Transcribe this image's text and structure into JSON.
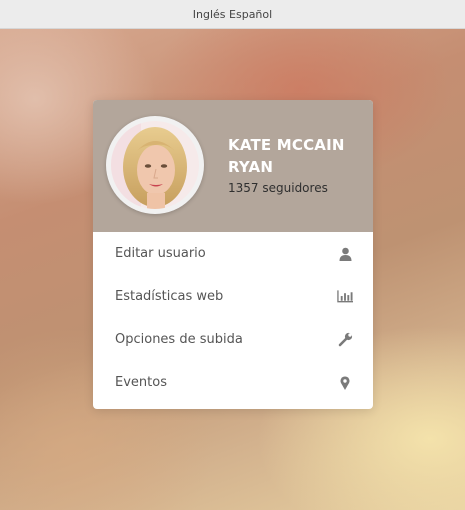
{
  "window": {
    "title": "Inglés Español"
  },
  "profile": {
    "name": "KATE MCCAIN RYAN",
    "followers_count": "1357",
    "followers_label": "seguidores"
  },
  "menu": {
    "items": [
      {
        "label": "Editar usuario",
        "icon": "user-icon"
      },
      {
        "label": "Estadísticas web",
        "icon": "bar-chart-icon"
      },
      {
        "label": "Opciones de subida",
        "icon": "wrench-icon"
      },
      {
        "label": "Eventos",
        "icon": "map-marker-icon"
      }
    ]
  },
  "colors": {
    "header": "#b3a69b",
    "card": "#ffffff",
    "icon": "#777777",
    "menu_text": "#555555"
  }
}
